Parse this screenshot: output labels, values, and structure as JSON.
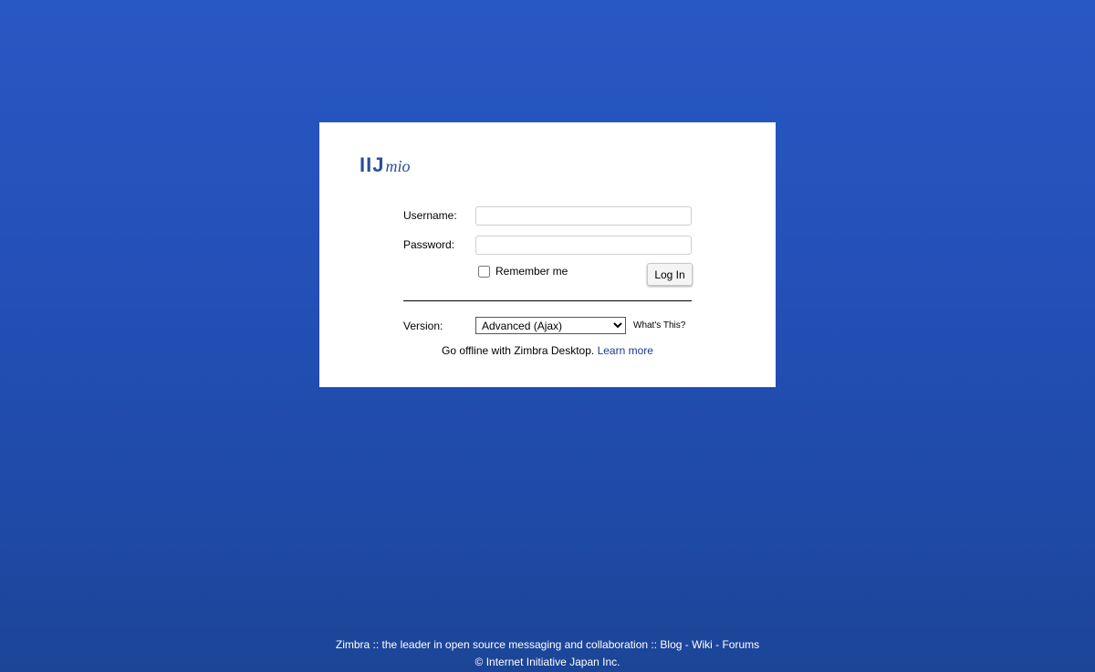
{
  "logo": {
    "main": "IIJ",
    "script": "mio"
  },
  "form": {
    "username_label": "Username:",
    "username_value": "",
    "password_label": "Password:",
    "password_value": "",
    "remember_label": "Remember me",
    "remember_checked": false,
    "login_button": "Log In",
    "version_label": "Version:",
    "version_selected": "Advanced (Ajax)",
    "whats_this": "What's This?"
  },
  "offline": {
    "text": "Go offline with Zimbra Desktop.",
    "link": "Learn more"
  },
  "footer": {
    "zimbra": "Zimbra",
    "sep1": " :: ",
    "tagline": "the leader in open source messaging and collaboration",
    "sep2": " :: ",
    "blog": "Blog",
    "dash1": " - ",
    "wiki": "Wiki",
    "dash2": " - ",
    "forums": "Forums",
    "copyright": "© Internet Initiative Japan Inc."
  },
  "colors": {
    "background_top": "#2858c4",
    "background_bottom": "#1c4597",
    "logo": "#2a4f9a",
    "link": "#1a3a8f"
  }
}
